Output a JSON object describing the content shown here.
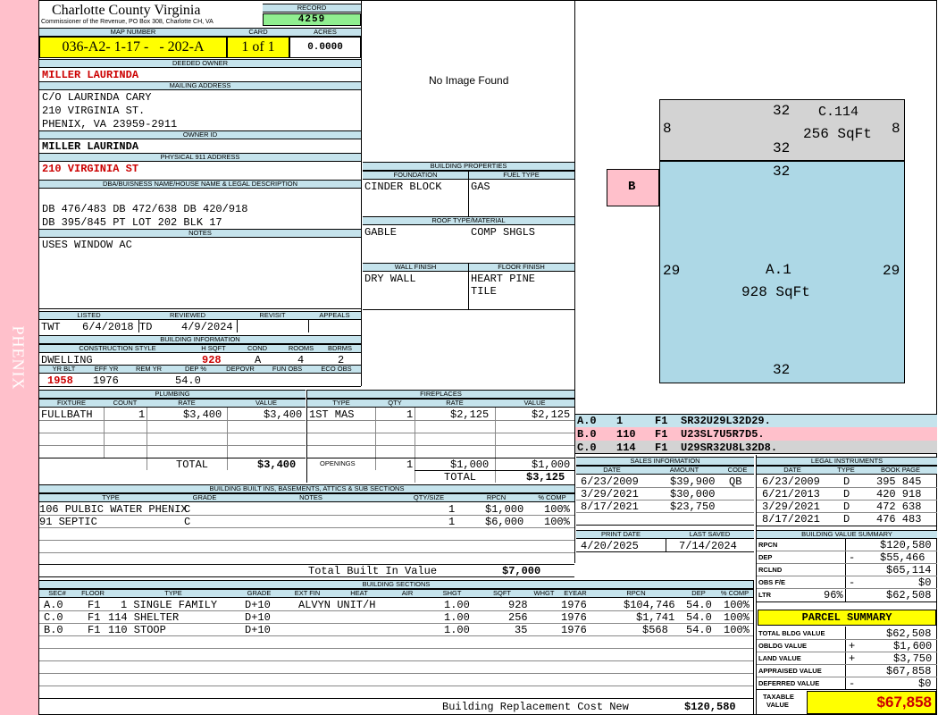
{
  "side_label": "PHENIX",
  "header": {
    "county": "Charlotte County Virginia",
    "commissioner": "Commissioner of the  Revenue, PO Box 308, Charlotte CH, VA",
    "record_label": "RECORD",
    "record": "4259",
    "map_label": "MAP NUMBER",
    "map": "036-A2- 1-17 -   - 202-A",
    "card_label": "CARD",
    "card": "1 of 1",
    "acres_label": "ACRES",
    "acres": "0.0000"
  },
  "owner": {
    "deeded_label": "DEEDED OWNER",
    "deeded": "MILLER LAURINDA",
    "mailing_label": "MAILING ADDRESS",
    "mail1": "C/O LAURINDA CARY",
    "mail2": "210 VIRGINIA ST.",
    "mail3": "PHENIX, VA 23959-2911",
    "ownerid_label": "OWNER ID",
    "ownerid": "MILLER LAURINDA",
    "addr911_label": "PHYSICAL 911 ADDRESS",
    "addr911": "210 VIRGINIA ST",
    "dba_label": "DBA/BUISNESS NAME/HOUSE NAME & LEGAL DESCRIPTION",
    "legal1": "DB 476/483 DB 472/638 DB 420/918",
    "legal2": "DB 395/845 PT LOT 202 BLK 17",
    "notes_label": "NOTES",
    "notes": "USES WINDOW AC"
  },
  "image": {
    "placeholder": "No Image Found"
  },
  "bldg_props": {
    "title": "BUILDING PROPERTIES",
    "foundation_label": "FOUNDATION",
    "foundation": "CINDER BLOCK",
    "fuel_label": "FUEL TYPE",
    "fuel": "GAS",
    "roof_label": "ROOF TYPE/MATERIAL",
    "roof_type": "GABLE",
    "roof_mat": "COMP SHGLS",
    "wall_label": "WALL FINISH",
    "wall": "DRY WALL",
    "floor_label": "FLOOR FINISH",
    "floor1": "HEART PINE",
    "floor2": "TILE"
  },
  "listing": {
    "listed_label": "LISTED",
    "lister": "TWT",
    "listed": "6/4/2018",
    "reviewed_label": "REVIEWED",
    "reviewer": "TD",
    "reviewed": "4/9/2024",
    "revisit_label": "REVISIT",
    "appeals_label": "APPEALS"
  },
  "bldg_info": {
    "title": "BUILDING INFORMATION",
    "h_style": "CONSTRUCTION STYLE",
    "h_sqft": "H SQFT",
    "h_cond": "COND",
    "h_rooms": "ROOMS",
    "h_bdrms": "BDRMS",
    "style": "DWELLING",
    "sqft": "928",
    "cond": "A",
    "rooms": "4",
    "bdrms": "2",
    "h_yrblt": "YR BLT",
    "h_effyr": "EFF YR",
    "h_remyr": "REM YR",
    "h_dep": "DEP %",
    "h_depovr": "DEPOVR",
    "h_funobs": "FUN OBS",
    "h_ecoobs": "ECO OBS",
    "yrblt": "1958",
    "effyr": "1976",
    "dep": "54.0"
  },
  "plumbing": {
    "title": "PLUMBING",
    "headers": [
      "FIXTURE",
      "COUNT",
      "RATE",
      "VALUE"
    ],
    "row": [
      "FULLBATH",
      "1",
      "$3,400",
      "$3,400"
    ],
    "total_label": "TOTAL",
    "total": "$3,400"
  },
  "fireplaces": {
    "title": "FIREPLACES",
    "headers": [
      "TYPE",
      "QTY",
      "RATE",
      "VALUE"
    ],
    "row": [
      "1ST MAS",
      "1",
      "$2,125",
      "$2,125"
    ],
    "openings": [
      "OPENINGS",
      "1",
      "$1,000",
      "$1,000"
    ],
    "total_label": "TOTAL",
    "total": "$3,125"
  },
  "builtins": {
    "title": "BUILDING BUILT INS, BASEMENTS, ATTICS & SUB SECTIONS",
    "headers": [
      "TYPE",
      "GRADE",
      "NOTES",
      "QTY/SIZE",
      "RPCN",
      "% COMP"
    ],
    "rows": [
      [
        "106 PULBIC WATER PHENIX",
        "C",
        "",
        "1",
        "$1,000",
        "100%"
      ],
      [
        "91 SEPTIC",
        "C",
        "",
        "1",
        "$6,000",
        "100%"
      ]
    ],
    "total_label": "Total Built In Value",
    "total": "$7,000"
  },
  "sections": {
    "title": "BUILDING SECTIONS",
    "headers": [
      "SEC#",
      "FLOOR",
      "TYPE",
      "GRADE",
      "EXT FIN",
      "HEAT",
      "AIR",
      "SHGT",
      "SQFT",
      "WHGT",
      "EYEAR",
      "RPCN",
      "DEP",
      "% COMP"
    ],
    "rows": [
      [
        "A.0",
        "F1",
        "1 SINGLE FAMILY",
        "D+10",
        "",
        "ALVYN UNIT/H",
        "",
        "1.00",
        "928",
        "",
        "1976",
        "$104,746",
        "54.0",
        "100%"
      ],
      [
        "C.0",
        "F1",
        "114 SHELTER",
        "D+10",
        "",
        "",
        "",
        "1.00",
        "256",
        "",
        "1976",
        "$1,741",
        "54.0",
        "100%"
      ],
      [
        "B.0",
        "F1",
        "110 STOOP",
        "D+10",
        "",
        "",
        "",
        "1.00",
        "35",
        "",
        "1976",
        "$568",
        "54.0",
        "100%"
      ]
    ],
    "total_label": "Building Replacement Cost New",
    "total": "$120,580"
  },
  "sketch": {
    "c_label": "C.114",
    "c_area": "256 SqFt",
    "a_label": "A.1",
    "a_area": "928 SqFt",
    "b_label": "B",
    "d32": "32",
    "d8": "8",
    "d29": "29"
  },
  "vectors": [
    {
      "sec": "A.0",
      "code": "1",
      "floor": "F1",
      "path": "SR32U29L32D29.",
      "color": "#c5e3ec"
    },
    {
      "sec": "B.0",
      "code": "110",
      "floor": "F1",
      "path": "U23SL7U5R7D5.",
      "color": "#ffc0cb"
    },
    {
      "sec": "C.0",
      "code": "114",
      "floor": "F1",
      "path": "U29SR32U8L32D8.",
      "color": "#d3d3d3"
    }
  ],
  "sales": {
    "title": "SALES INFORMATION",
    "headers": [
      "DATE",
      "AMOUNT",
      "CODE"
    ],
    "rows": [
      [
        "6/23/2009",
        "$39,900",
        "QB"
      ],
      [
        "3/29/2021",
        "$30,000",
        ""
      ],
      [
        "8/17/2021",
        "$23,750",
        ""
      ]
    ]
  },
  "legal": {
    "title": "LEGAL INSTRUMENTS",
    "headers": [
      "DATE",
      "TYPE",
      "BOOK PAGE"
    ],
    "rows": [
      [
        "6/23/2009",
        "D",
        "395 845"
      ],
      [
        "6/21/2013",
        "D",
        "420 918"
      ],
      [
        "3/29/2021",
        "D",
        "472 638"
      ],
      [
        "8/17/2021",
        "D",
        "476 483"
      ]
    ]
  },
  "dates": {
    "print_label": "PRINT DATE",
    "print": "4/20/2025",
    "saved_label": "LAST SAVED",
    "saved": "7/14/2024"
  },
  "value_summary": {
    "title": "BUILDING VALUE SUMMARY",
    "rows": [
      [
        "RPCN",
        "",
        "",
        "$120,580"
      ],
      [
        "DEP",
        "",
        "-",
        "$55,466"
      ],
      [
        "RCLND",
        "",
        "",
        "$65,114"
      ],
      [
        "OBS F/E",
        "",
        "-",
        "$0"
      ],
      [
        "LTR",
        "96%",
        "",
        "$62,508"
      ]
    ]
  },
  "parcel": {
    "title": "PARCEL SUMMARY",
    "rows": [
      [
        "TOTAL BLDG VALUE",
        "",
        "$62,508"
      ],
      [
        "OBLDG VALUE",
        "+",
        "$1,600"
      ],
      [
        "LAND VALUE",
        "+",
        "$3,750"
      ],
      [
        "APPRAISED VALUE",
        "",
        "$67,858"
      ],
      [
        "DEFERRED VALUE",
        "-",
        "$0"
      ]
    ],
    "taxable_label1": "TAXABLE",
    "taxable_label2": "VALUE",
    "taxable": "$67,858"
  },
  "colors": {
    "header_blue": "#c5e3ec",
    "yellow": "#ffff00",
    "green": "#90ee90",
    "pink": "#ffc0cb",
    "red": "#cc0000",
    "gray": "#d3d3d3"
  }
}
